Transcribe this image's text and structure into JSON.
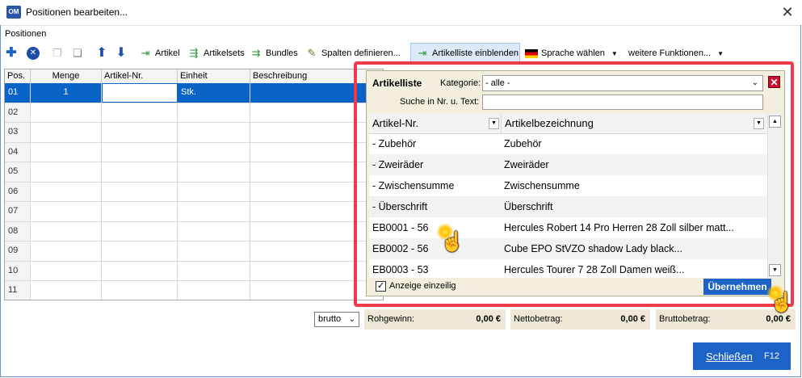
{
  "window": {
    "title": "Positionen bearbeiten...",
    "app_icon_text": "OM",
    "close_glyph": "✕"
  },
  "section_label": "Positionen",
  "toolbar": {
    "artikel": "Artikel",
    "artikelsets": "Artikelsets",
    "bundles": "Bundles",
    "spalten": "Spalten definieren...",
    "artikelliste": "Artikelliste einblenden",
    "sprache": "Sprache wählen",
    "weitere": "weitere Funktionen..."
  },
  "grid": {
    "columns": [
      "Pos.",
      "Menge",
      "Artikel-Nr.",
      "Einheit",
      "Beschreibung"
    ],
    "rows": [
      {
        "pos": "01",
        "menge": "1",
        "einheit": "Stk."
      },
      {
        "pos": "02"
      },
      {
        "pos": "03"
      },
      {
        "pos": "04"
      },
      {
        "pos": "05"
      },
      {
        "pos": "06"
      },
      {
        "pos": "07"
      },
      {
        "pos": "08"
      },
      {
        "pos": "09"
      },
      {
        "pos": "10"
      },
      {
        "pos": "11"
      }
    ]
  },
  "totals": {
    "mode": "brutto",
    "rohgewinn_label": "Rohgewinn:",
    "rohgewinn_value": "0,00 €",
    "netto_label": "Nettobetrag:",
    "netto_value": "0,00 €",
    "brutto_label": "Bruttobetrag:",
    "brutto_value": "0,00 €"
  },
  "close_button": {
    "label": "Schließen",
    "shortcut": "F12"
  },
  "artikelliste": {
    "title": "Artikelliste",
    "kategorie_label": "Kategorie:",
    "kategorie_value": "- alle -",
    "close_glyph": "✕",
    "search_label": "Suche in Nr. u. Text:",
    "search_value": "",
    "columns": [
      "Artikel-Nr.",
      "Artikelbezeichnung"
    ],
    "rows": [
      {
        "nr": "- Zubehör",
        "bez": "Zubehör"
      },
      {
        "nr": "- Zweiräder",
        "bez": "Zweiräder"
      },
      {
        "nr": "- Zwischensumme",
        "bez": "Zwischensumme"
      },
      {
        "nr": "- Überschrift",
        "bez": "Überschrift"
      },
      {
        "nr": "EB0001 - 56",
        "bez": "Hercules Robert 14 Pro Herren 28 Zoll silber matt..."
      },
      {
        "nr": "EB0002 - 56",
        "bez": "Cube EPO StVZO shadow Lady black..."
      },
      {
        "nr": "EB0003 - 53",
        "bez": "Hercules Tourer 7 28 Zoll Damen weiß..."
      }
    ],
    "einzeilig_label": "Anzeige einzeilig",
    "einzeilig_checked": true,
    "uebernehmen_label": "Übernehmen"
  },
  "colors": {
    "accent": "#1d63c7",
    "highlight_frame": "#ee3b4a",
    "selected_row": "#0a64c8"
  }
}
